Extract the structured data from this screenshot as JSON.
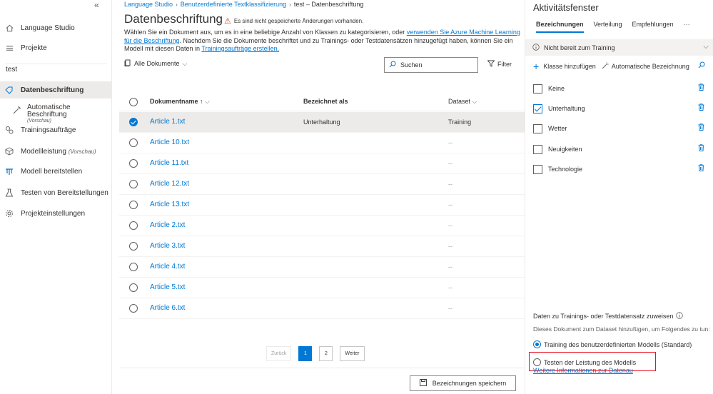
{
  "sidebar": {
    "collapse_icon": "«",
    "items": [
      {
        "label": "Language Studio",
        "icon": "home-icon"
      },
      {
        "label": "Projekte",
        "icon": "list-icon"
      }
    ],
    "project_name": "test",
    "project_items": [
      {
        "label": "Datenbeschriftung",
        "icon": "tag-icon",
        "active": true
      },
      {
        "label": "Automatische Beschriftung",
        "sub": "(Vorschau)",
        "icon": "wand-icon"
      },
      {
        "label": "Trainingsaufträge",
        "icon": "gear-flow-icon"
      },
      {
        "label": "Modellleistung",
        "preview": "(Vorschau)",
        "icon": "cube-icon"
      },
      {
        "label": "Modell bereitstellen",
        "icon": "deploy-icon"
      },
      {
        "label": "Testen von Bereitstellungen",
        "icon": "flask-icon"
      },
      {
        "label": "Projekteinstellungen",
        "icon": "settings-icon"
      }
    ]
  },
  "breadcrumb": [
    "Language Studio",
    "Benutzerdefinierte Textklassifizierung",
    "test – Datenbeschriftung"
  ],
  "page": {
    "title": "Datenbeschriftung",
    "warning": "Es sind nicht gespeicherte Änderungen vorhanden.",
    "desc_1": "Wählen Sie ein Dokument aus, um es in eine beliebige Anzahl von Klassen zu kategorisieren, oder ",
    "desc_link_1": "verwenden Sie Azure Machine Learning für die Beschriftung",
    "desc_2": ". Nachdem Sie die Dokumente beschriftet und zu Trainings- oder Testdatensätzen hinzugefügt haben, können Sie ein Modell mit diesen Daten in ",
    "desc_link_2": "Trainingsaufträge erstellen.",
    "doc_filter": "Alle Dokumente",
    "search_placeholder": "Suchen",
    "filter_label": "Filter"
  },
  "table": {
    "headers": {
      "name": "Dokumentname ↑",
      "label": "Bezeichnet als",
      "dataset": "Dataset"
    },
    "rows": [
      {
        "name": "Article 1.txt",
        "label": "Unterhaltung",
        "dataset": "Training",
        "selected": true
      },
      {
        "name": "Article 10.txt",
        "label": "",
        "dataset": "--"
      },
      {
        "name": "Article 11.txt",
        "label": "",
        "dataset": "--"
      },
      {
        "name": "Article 12.txt",
        "label": "",
        "dataset": "--"
      },
      {
        "name": "Article 13.txt",
        "label": "",
        "dataset": "--"
      },
      {
        "name": "Article 2.txt",
        "label": "",
        "dataset": "--"
      },
      {
        "name": "Article 3.txt",
        "label": "",
        "dataset": "--"
      },
      {
        "name": "Article 4.txt",
        "label": "",
        "dataset": "--"
      },
      {
        "name": "Article 5.txt",
        "label": "",
        "dataset": "--"
      },
      {
        "name": "Article 6.txt",
        "label": "",
        "dataset": "--"
      }
    ]
  },
  "pager": {
    "prev": "Zurück",
    "pages": [
      "1",
      "2"
    ],
    "next": "Weiter"
  },
  "save_button": "Bezeichnungen speichern",
  "panel": {
    "title": "Aktivitätsfenster",
    "tabs": [
      "Bezeichnungen",
      "Verteilung",
      "Empfehlungen",
      "···"
    ],
    "status": "Nicht bereit zum Training",
    "add_class": "Klasse hinzufügen",
    "auto_label": "Automatische Bezeichnung",
    "labels": [
      {
        "name": "Keine",
        "checked": false
      },
      {
        "name": "Unterhaltung",
        "checked": true
      },
      {
        "name": "Wetter",
        "checked": false
      },
      {
        "name": "Neuigkeiten",
        "checked": false
      },
      {
        "name": "Technologie",
        "checked": false
      }
    ],
    "assign_title": "Daten zu Trainings- oder Testdatensatz zuweisen",
    "assign_desc": "Dieses Dokument zum Dataset hinzufügen, um Folgendes zu tun:",
    "option_train": "Training des benutzerdefinierten Modells (Standard)",
    "option_test": "Testen der Leistung des Modells",
    "more_link": "Weitere Informationen zur Datenau"
  },
  "colors": {
    "accent": "#0078d4",
    "warning": "#d83b01",
    "highlight": "#e81123"
  }
}
